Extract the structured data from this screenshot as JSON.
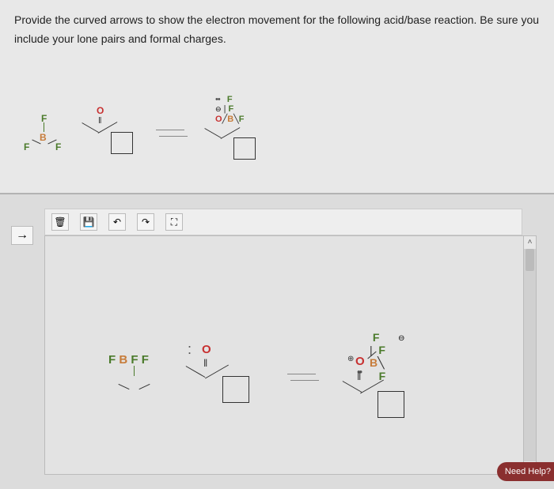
{
  "question": {
    "line1": "Provide the curved arrows to show the electron movement for the following acid/base reaction. Be sure you",
    "line2": "include your lone pairs and formal charges."
  },
  "atoms": {
    "F": "F",
    "O": "O",
    "B": "B"
  },
  "symbols": {
    "lone_pair": "••",
    "lone_pair_single": ":",
    "double_bond": "‖",
    "neg_charge": "⊖",
    "pos_charge": "⊕",
    "eq_arrow_note": "equilibrium"
  },
  "toolbar": {
    "trash": "🗑",
    "save": "💾",
    "undo": "↶",
    "redo": "↷",
    "expand": "⛶",
    "side_arrow": "→"
  },
  "scroll": {
    "up": "˄",
    "down": "˅"
  },
  "help": {
    "label": "Need Help?"
  },
  "reactants": {
    "bf3": {
      "atoms": [
        "F",
        "F",
        "F",
        "B"
      ]
    },
    "ketone": {
      "oxygen": "O",
      "ring": "cyclobutyl"
    }
  },
  "product": {
    "obf3": {
      "O_charge": "+",
      "B_charge": "-",
      "fluorines": 3
    }
  }
}
